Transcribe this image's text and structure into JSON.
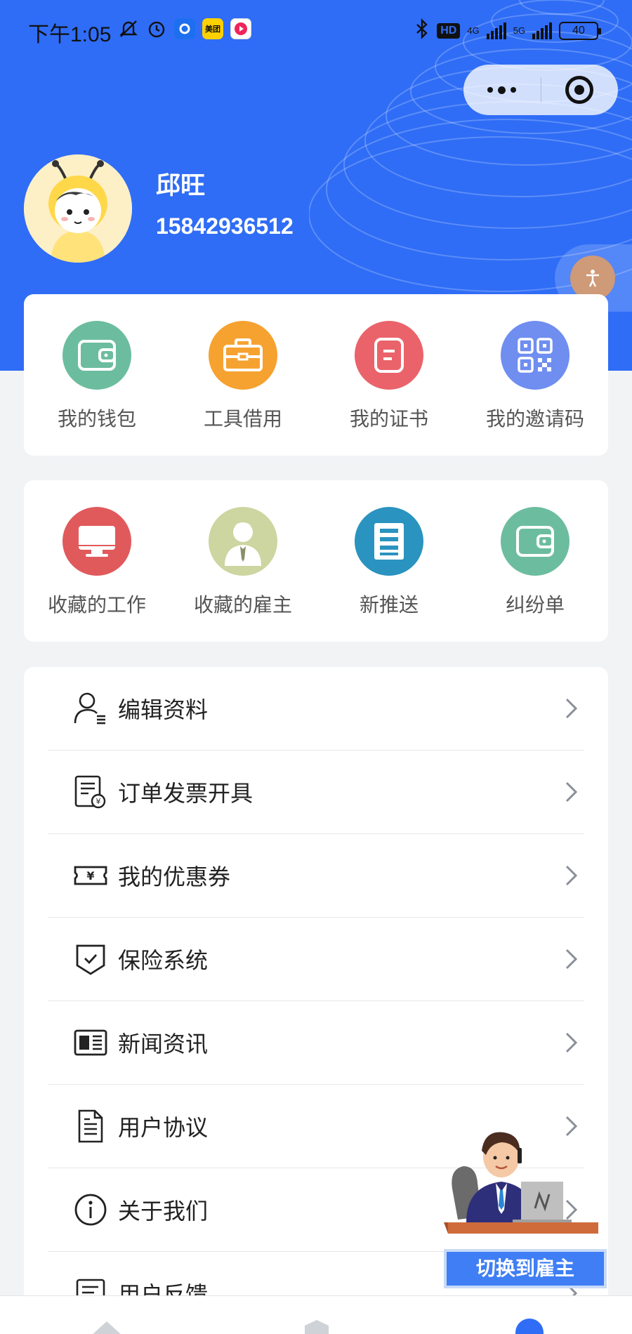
{
  "status_bar": {
    "time": "下午1:05",
    "app_badge_meituan": "美团",
    "hd": "HD",
    "net1": "4G",
    "net2": "5G",
    "battery": "40"
  },
  "profile": {
    "name": "邱旺",
    "phone": "15842936512"
  },
  "quick_actions_1": [
    {
      "label": "我的钱包",
      "icon": "wallet-icon",
      "color": "#6cbd9f"
    },
    {
      "label": "工具借用",
      "icon": "toolbox-icon",
      "color": "#f6a230"
    },
    {
      "label": "我的证书",
      "icon": "certificate-icon",
      "color": "#ea636b"
    },
    {
      "label": "我的邀请码",
      "icon": "qrcode-icon",
      "color": "#6f8ef0"
    }
  ],
  "quick_actions_2": [
    {
      "label": "收藏的工作",
      "icon": "monitor-icon",
      "color": "#e05a5c"
    },
    {
      "label": "收藏的雇主",
      "icon": "businessman-icon",
      "color": "#cdd5a0"
    },
    {
      "label": "新推送",
      "icon": "document-icon",
      "color": "#2a93c0"
    },
    {
      "label": "纠纷单",
      "icon": "wallet-icon",
      "color": "#6cbd9f"
    }
  ],
  "menu": [
    {
      "label": "编辑资料",
      "icon": "edit-profile-icon"
    },
    {
      "label": "订单发票开具",
      "icon": "invoice-icon"
    },
    {
      "label": "我的优惠券",
      "icon": "coupon-icon"
    },
    {
      "label": "保险系统",
      "icon": "shield-check-icon"
    },
    {
      "label": "新闻资讯",
      "icon": "news-icon"
    },
    {
      "label": "用户协议",
      "icon": "agreement-icon"
    },
    {
      "label": "关于我们",
      "icon": "info-icon"
    },
    {
      "label": "用户反馈",
      "icon": "feedback-icon"
    }
  ],
  "switch_role": {
    "label": "切换到雇主"
  },
  "colors": {
    "brand_blue": "#2f6df6",
    "switch_blue": "#3f7ef4"
  }
}
